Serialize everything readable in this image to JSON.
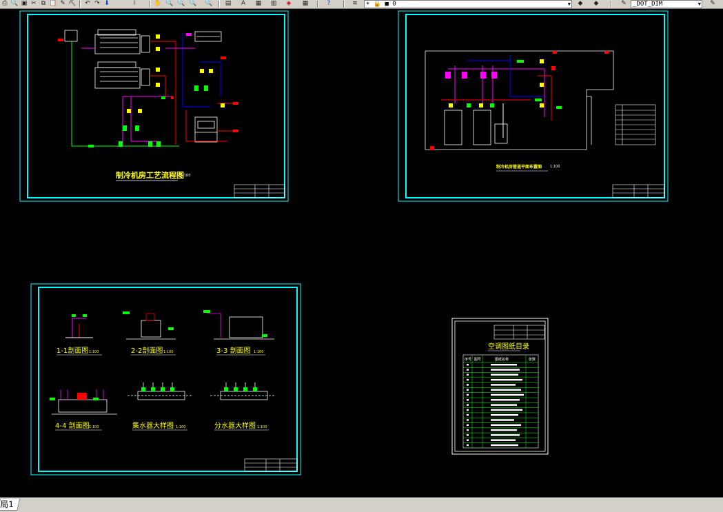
{
  "toolbar": {
    "layer_combo_value": "0",
    "layer_combo_prefix": "☀ 🔓 ■",
    "dimstyle_combo_value": "_DOT_DIM",
    "icons": [
      "plot-icon",
      "preview-icon",
      "publish-icon",
      "cut-icon",
      "copy-icon",
      "paste-icon",
      "undo-icon",
      "redo-icon",
      "pan-icon",
      "zoom-realtime-icon",
      "zoom-window-icon",
      "zoom-previous-icon",
      "properties-icon",
      "designcenter-icon",
      "toolpalette-icon",
      "calculator-icon",
      "help-icon",
      "layer-icon",
      "layer-states-icon",
      "make-current-icon",
      "layer-previous-icon"
    ]
  },
  "drawing": {
    "sheet1": {
      "title": "制冷机房工艺流程图",
      "scale": "1:100"
    },
    "sheet2": {
      "title": "制冷机房管道平面布置图",
      "scale": "1:100"
    },
    "sheet3": {
      "labels": [
        {
          "name": "1-1剖面图",
          "scale": "1:100"
        },
        {
          "name": "2-2剖面图",
          "scale": "1:100"
        },
        {
          "name": "3-3 剖面图",
          "scale": "1:100"
        },
        {
          "name": "4-4 剖面图",
          "scale": "1:100"
        },
        {
          "name": "集水器大样图",
          "scale": "1:100"
        },
        {
          "name": "分水器大样图",
          "scale": "1:100"
        }
      ]
    },
    "sheet4": {
      "title": "空调图纸目录",
      "table_headers": [
        "序号",
        "图号",
        "图纸名称",
        "张数"
      ],
      "row_count": 17
    }
  },
  "statusbar": {
    "layout_tab": "局1"
  },
  "colors": {
    "background": "#000000",
    "frame_cyan": "#00ffff",
    "frame_white": "#ffffff",
    "title_yellow": "#ffff00",
    "pipe_red": "#ff0000",
    "pipe_magenta": "#ff00ff",
    "pipe_blue": "#0000ff",
    "pipe_green": "#00ff00"
  }
}
